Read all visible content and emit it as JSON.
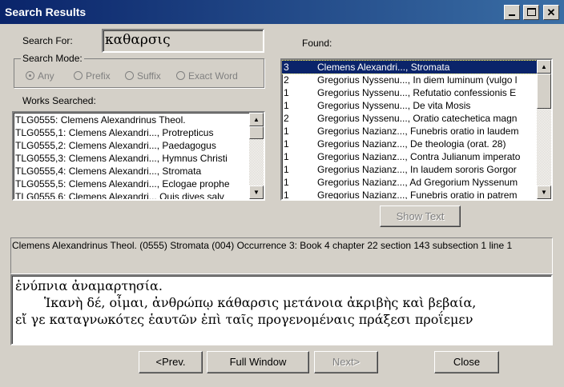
{
  "window": {
    "title": "Search Results"
  },
  "search": {
    "label": "Search For:",
    "value": "καθαρσις",
    "mode_label": "Search Mode:",
    "modes": [
      "Any",
      "Prefix",
      "Suffix",
      "Exact Word"
    ],
    "selected_mode": "Any"
  },
  "works": {
    "label": "Works Searched:",
    "items": [
      "TLG0555:  Clemens Alexandrinus Theol.",
      "TLG0555,1: Clemens Alexandri..., Protrepticus",
      "TLG0555,2: Clemens Alexandri..., Paedagogus",
      "TLG0555,3: Clemens Alexandri..., Hymnus Christi",
      "TLG0555,4: Clemens Alexandri..., Stromata",
      "TLG0555,5: Clemens Alexandri..., Eclogae prophe",
      "TLG0555,6: Clemens Alexandri... Quis dives salv"
    ]
  },
  "found": {
    "label": "Found:",
    "rows": [
      {
        "count": "3",
        "text": "Clemens Alexandri..., Stromata",
        "selected": true
      },
      {
        "count": "2",
        "text": "Gregorius Nyssenu..., In diem luminum (vulgo l"
      },
      {
        "count": "1",
        "text": "Gregorius Nyssenu..., Refutatio confessionis E"
      },
      {
        "count": "1",
        "text": "Gregorius Nyssenu..., De vita Mosis"
      },
      {
        "count": "2",
        "text": "Gregorius Nyssenu..., Oratio catechetica magn"
      },
      {
        "count": "1",
        "text": "Gregorius Nazianz..., Funebris oratio in laudem"
      },
      {
        "count": "1",
        "text": "Gregorius Nazianz..., De theologia (orat. 28)"
      },
      {
        "count": "1",
        "text": "Gregorius Nazianz..., Contra Julianum imperato"
      },
      {
        "count": "1",
        "text": "Gregorius Nazianz..., In laudem sororis Gorgor"
      },
      {
        "count": "1",
        "text": "Gregorius Nazianz..., Ad Gregorium Nyssenum"
      },
      {
        "count": "1",
        "text": "Gregorius Nazianz..., Funebris oratio in patrem"
      }
    ],
    "show_text_label": "Show Text"
  },
  "occurrence": {
    "citation": "Clemens Alexandrinus Theol. (0555) Stromata  (004) Occurrence 3: Book 4 chapter 22 section 143 subsection 1 line 1",
    "lines": [
      "ἐνύπνια ἀναμαρτησία.",
      "Ἱκανὴ δέ, οἶμαι, ἀνθρώπῳ κάθαρσις μετάνοια ἀκριβὴς καὶ βεβαία,",
      "εἴ γε καταγνωκότες ἑαυτῶν ἐπὶ ταῖς προγενομέναις πράξεσι προΐεμεν"
    ]
  },
  "buttons": {
    "prev": "<Prev.",
    "full_window": "Full Window",
    "next": "Next>",
    "close": "Close"
  },
  "icons": {
    "minimize": "minimize-icon",
    "maximize": "maximize-icon",
    "close": "close-icon",
    "scroll_up": "scroll-up-icon",
    "scroll_down": "scroll-down-icon"
  },
  "colors": {
    "title_bar": "#0a246a",
    "selection": "#0a246a",
    "face": "#d4d0c8"
  }
}
